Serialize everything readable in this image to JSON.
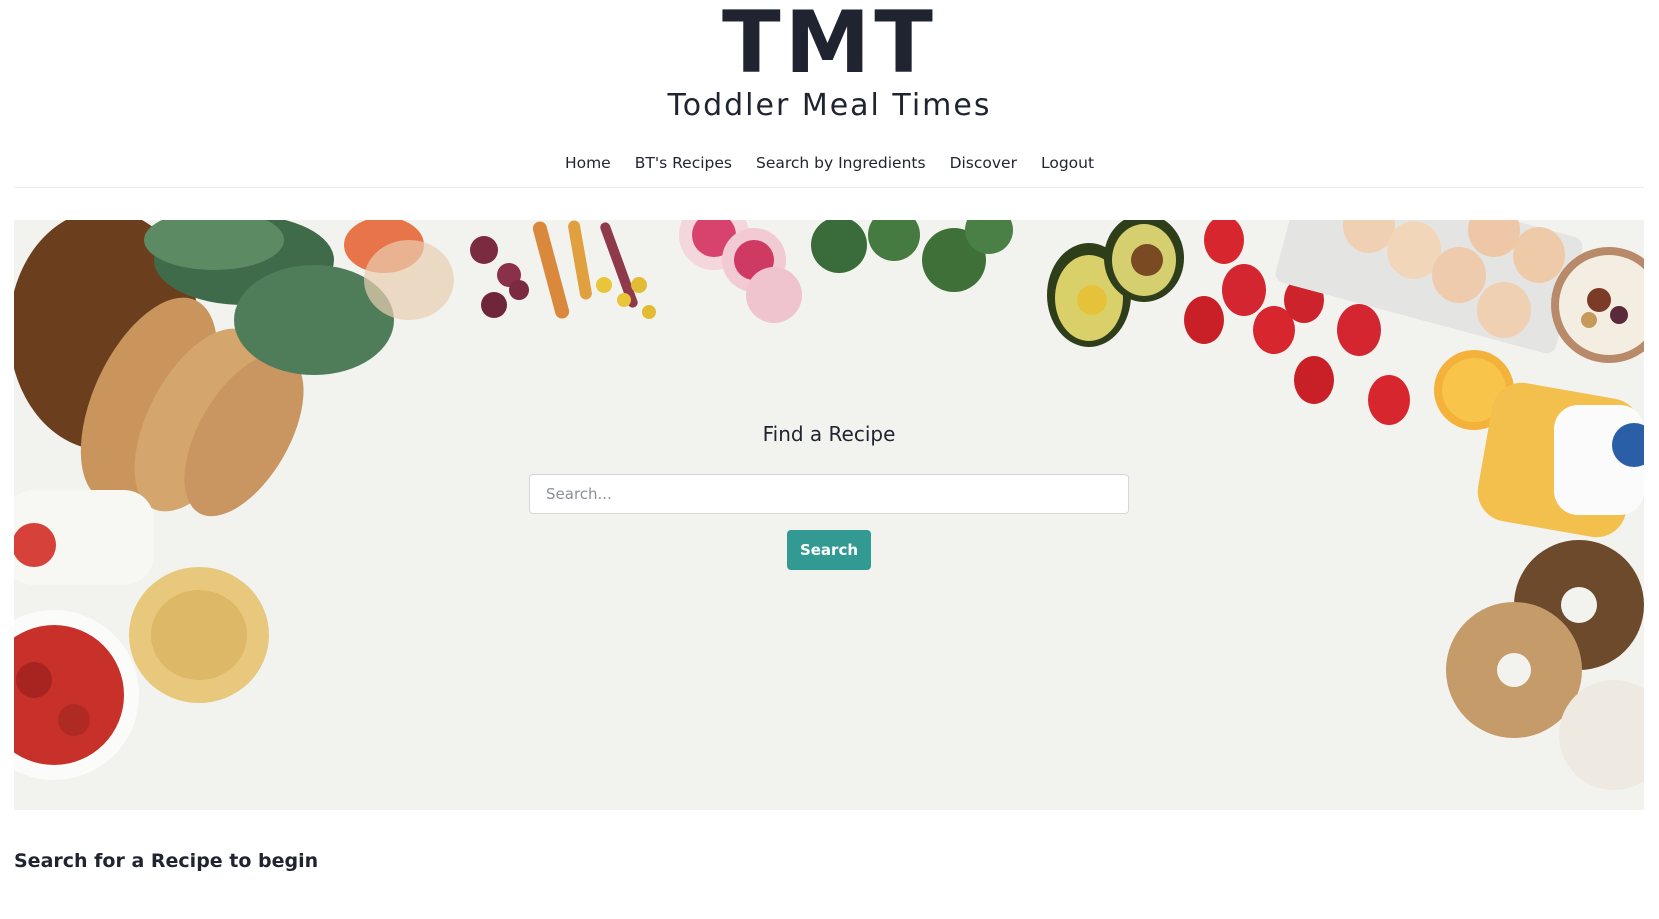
{
  "header": {
    "logo": "TMT",
    "tagline": "Toddler Meal Times"
  },
  "nav": {
    "items": [
      {
        "label": "Home"
      },
      {
        "label": "BT's Recipes"
      },
      {
        "label": "Search by Ingredients"
      },
      {
        "label": "Discover"
      },
      {
        "label": "Logout"
      }
    ]
  },
  "hero": {
    "title": "Find a Recipe",
    "search_placeholder": "Search...",
    "search_button": "Search",
    "background": "food-border-photo"
  },
  "results": {
    "prompt": "Search for a Recipe to begin"
  },
  "colors": {
    "accent": "#329a93",
    "text": "#1f2430",
    "hero_bg": "#f2f2ef"
  }
}
